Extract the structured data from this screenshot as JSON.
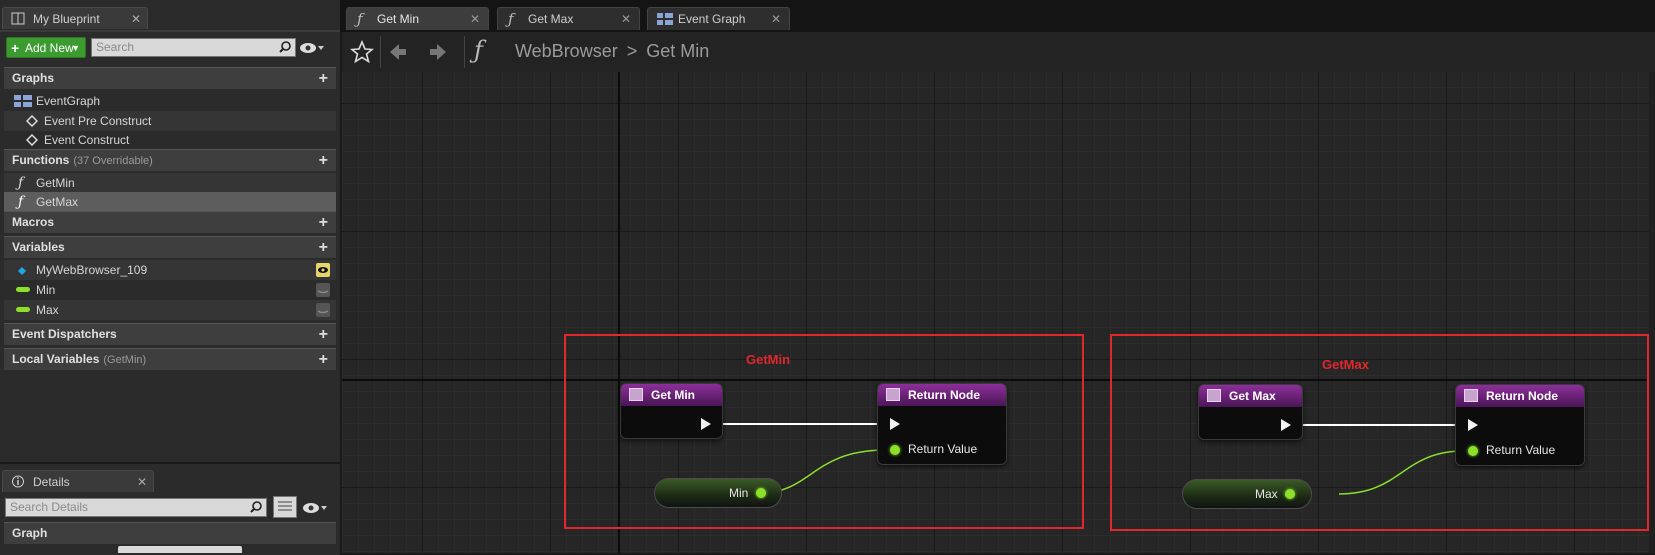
{
  "my_blueprint": {
    "tab_label": "My Blueprint",
    "add_new_label": "Add New",
    "search_placeholder": "Search",
    "sections": {
      "graphs": {
        "label": "Graphs",
        "items": [
          "EventGraph",
          "Event Pre Construct",
          "Event Construct"
        ]
      },
      "functions": {
        "label": "Functions",
        "sub": "(37 Overridable)",
        "items": [
          "GetMin",
          "GetMax"
        ]
      },
      "macros": {
        "label": "Macros"
      },
      "variables": {
        "label": "Variables",
        "items": [
          "MyWebBrowser_109",
          "Min",
          "Max"
        ]
      },
      "event_dispatchers": {
        "label": "Event Dispatchers"
      },
      "local_variables": {
        "label": "Local Variables",
        "sub": "(GetMin)"
      }
    }
  },
  "details": {
    "tab_label": "Details",
    "search_placeholder": "Search Details",
    "section_label": "Graph"
  },
  "doc_tabs": [
    "Get Min",
    "Get Max",
    "Event Graph"
  ],
  "breadcrumb": {
    "root": "WebBrowser",
    "separator": ">",
    "current": "Get Min"
  },
  "graph": {
    "comments": [
      "GetMin",
      "GetMax"
    ],
    "nodes": {
      "get_min": "Get Min",
      "get_max": "Get Max",
      "return_node": "Return Node",
      "return_value": "Return Value",
      "var_min": "Min",
      "var_max": "Max"
    }
  },
  "colors": {
    "comment_border": "#e0282c",
    "function_header": "#8c2f9a",
    "float_pin": "#8be02a",
    "add_new": "#3c9b2f"
  }
}
